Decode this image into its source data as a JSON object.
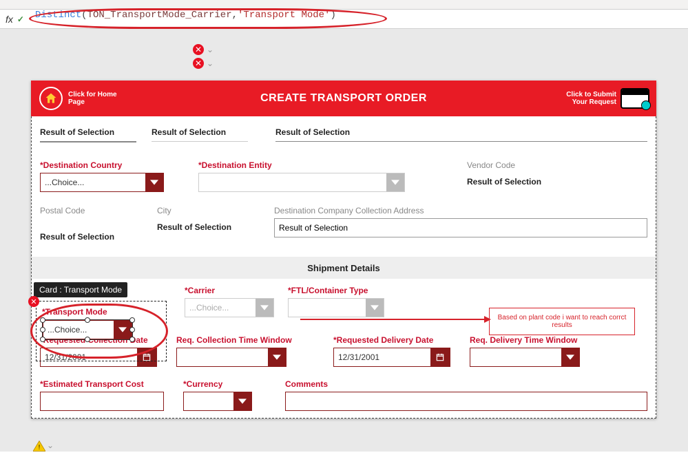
{
  "formula": {
    "fx": "fx",
    "fn": "Distinct",
    "p_open": "(",
    "arg1": "TON_TransportMode_Carrier",
    "comma": ",",
    "arg2": "'Transport Mode'",
    "p_close": ")"
  },
  "tooltip": {
    "card": "Card : Transport Mode"
  },
  "header": {
    "home_line1": "Click for Home",
    "home_line2": "Page",
    "title": "CREATE TRANSPORT ORDER",
    "submit_line1": "Click to Submit",
    "submit_line2": "Your Request"
  },
  "row1": {
    "a": "Result of Selection",
    "b": "Result of Selection",
    "c": "Result of Selection"
  },
  "dest": {
    "country_lbl": "*Destination Country",
    "country_val": "...Choice...",
    "entity_lbl": "*Destination Entity",
    "entity_val": "",
    "vendor_lbl": "Vendor Code",
    "vendor_val": "Result of Selection"
  },
  "addr": {
    "postal_lbl": "Postal Code",
    "postal_val": "Result of Selection",
    "city_lbl": "City",
    "city_val": "Result of Selection",
    "collect_lbl": "Destination Company Collection Address",
    "collect_val": "Result of Selection"
  },
  "section": {
    "shipment": "Shipment Details"
  },
  "ship": {
    "mode_lbl": "*Transport Mode",
    "mode_val": "...Choice...",
    "carrier_lbl": "*Carrier",
    "carrier_val": "...Choice...",
    "ftl_lbl": "*FTL/Container Type",
    "ftl_val": ""
  },
  "annotation": {
    "text": "Based on plant code i want to reach corrct results"
  },
  "dates": {
    "req_coll_lbl": "*Requested Collection Date",
    "req_coll_val": "12/31/2001",
    "coll_tw_lbl": "Req. Collection Time Window",
    "coll_tw_val": "",
    "req_del_lbl": "*Requested Delivery Date",
    "req_del_val": "12/31/2001",
    "del_tw_lbl": "Req. Delivery Time Window",
    "del_tw_val": ""
  },
  "bottom": {
    "cost_lbl": "*Estimated Transport Cost",
    "cost_val": "",
    "currency_lbl": "*Currency",
    "currency_val": "",
    "comments_lbl": "Comments",
    "comments_val": ""
  },
  "glyphs": {
    "x": "✕",
    "chev": "⌄"
  }
}
